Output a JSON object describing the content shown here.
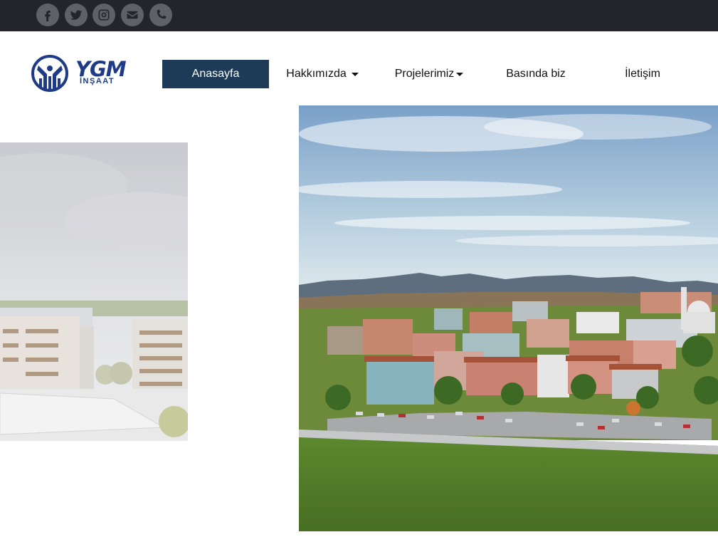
{
  "topbar": {
    "social": [
      {
        "icon": "facebook-icon"
      },
      {
        "icon": "twitter-icon"
      },
      {
        "icon": "instagram-icon"
      },
      {
        "icon": "envelope-icon"
      },
      {
        "icon": "phone-icon"
      }
    ]
  },
  "logo": {
    "name": "YGM",
    "sub": "İNŞAAT",
    "color": "#1f3b87"
  },
  "nav": {
    "home": "Anasayfa",
    "about": "Hakkımızda",
    "projects": "Projelerimiz",
    "press": "Basında biz",
    "contact": "İletişim",
    "active_color": "#1d3a56"
  },
  "slider": {
    "prev_image": "building-render-faded",
    "current_image": "housing-complex-render"
  }
}
